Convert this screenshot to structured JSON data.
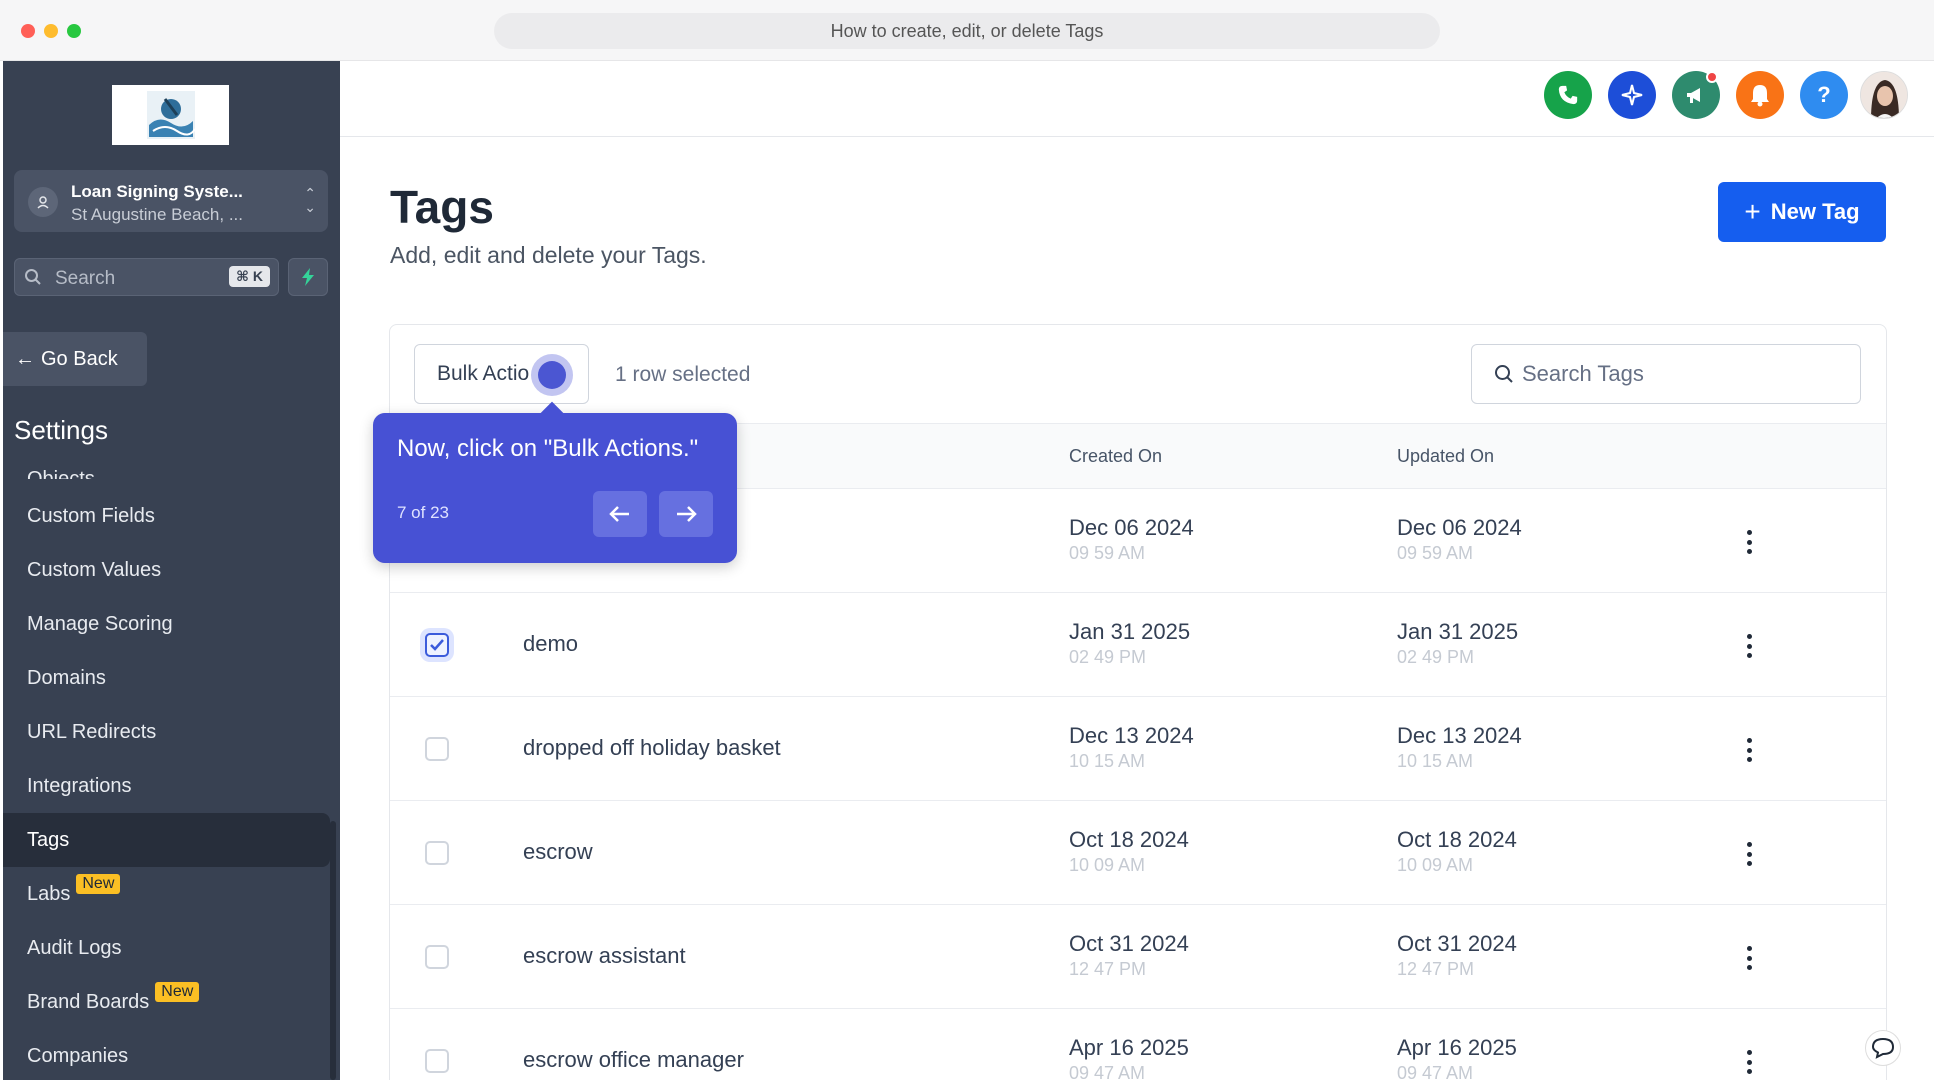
{
  "window": {
    "title": "How to create, edit, or delete Tags"
  },
  "sidebar": {
    "account_name": "Loan Signing Syste...",
    "account_location": "St Augustine Beach, ...",
    "search_placeholder": "Search",
    "search_shortcut": "⌘ K",
    "go_back": "Go Back",
    "section_title": "Settings",
    "items": [
      {
        "label": "Objects"
      },
      {
        "label": "Custom Fields"
      },
      {
        "label": "Custom Values"
      },
      {
        "label": "Manage Scoring"
      },
      {
        "label": "Domains"
      },
      {
        "label": "URL Redirects"
      },
      {
        "label": "Integrations"
      },
      {
        "label": "Tags",
        "active": true
      },
      {
        "label": "Labs",
        "badge": "New"
      },
      {
        "label": "Audit Logs"
      },
      {
        "label": "Brand Boards",
        "badge": "New"
      },
      {
        "label": "Companies"
      }
    ]
  },
  "header": {
    "icons": [
      "phone-icon",
      "sparkle-icon",
      "megaphone-icon",
      "bell-icon",
      "help-icon"
    ],
    "help_glyph": "?"
  },
  "page": {
    "title": "Tags",
    "subtitle": "Add, edit and delete your Tags.",
    "new_tag_label": "New Tag"
  },
  "toolbar": {
    "bulk_actions_label": "Bulk Actio",
    "row_selected": "1 row selected",
    "search_placeholder": "Search Tags"
  },
  "table": {
    "columns": [
      "Created On",
      "Updated On"
    ],
    "rows": [
      {
        "name": "",
        "checked": false,
        "created_date": "Dec 06 2024",
        "created_time": "09 59 AM",
        "updated_date": "Dec 06 2024",
        "updated_time": "09 59 AM"
      },
      {
        "name": "demo",
        "checked": true,
        "created_date": "Jan 31 2025",
        "created_time": "02 49 PM",
        "updated_date": "Jan 31 2025",
        "updated_time": "02 49 PM"
      },
      {
        "name": "dropped off holiday basket",
        "checked": false,
        "created_date": "Dec 13 2024",
        "created_time": "10 15 AM",
        "updated_date": "Dec 13 2024",
        "updated_time": "10 15 AM"
      },
      {
        "name": "escrow",
        "checked": false,
        "created_date": "Oct 18 2024",
        "created_time": "10 09 AM",
        "updated_date": "Oct 18 2024",
        "updated_time": "10 09 AM"
      },
      {
        "name": "escrow assistant",
        "checked": false,
        "created_date": "Oct 31 2024",
        "created_time": "12 47 PM",
        "updated_date": "Oct 31 2024",
        "updated_time": "12 47 PM"
      },
      {
        "name": "escrow office manager",
        "checked": false,
        "created_date": "Apr 16 2025",
        "created_time": "09 47 AM",
        "updated_date": "Apr 16 2025",
        "updated_time": "09 47 AM"
      }
    ]
  },
  "tooltip": {
    "text": "Now, click on \"Bulk Actions.\"",
    "step": "7 of 23"
  },
  "colors": {
    "accent": "#155eef",
    "sidebar_bg": "#384152",
    "tooltip_bg": "#4751d4"
  }
}
